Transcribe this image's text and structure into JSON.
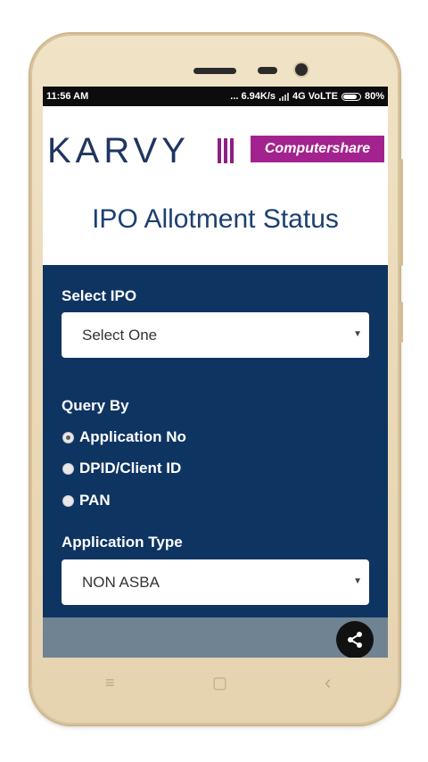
{
  "status_bar": {
    "time": "11:56 AM",
    "speed": "... 6.94K/s",
    "network": "4G VoLTE",
    "battery": "80%"
  },
  "header": {
    "logo_karvy": "KARVY",
    "logo_computershare": "Computershare",
    "title": "IPO Allotment Status"
  },
  "form": {
    "select_ipo_label": "Select IPO",
    "select_ipo_value": "Select One",
    "query_by_label": "Query By",
    "query_options": [
      {
        "label": "Application No",
        "selected": true
      },
      {
        "label": "DPID/Client ID",
        "selected": false
      },
      {
        "label": "PAN",
        "selected": false
      }
    ],
    "application_type_label": "Application Type",
    "application_type_value": "NON ASBA",
    "dropdown_caret": "▼"
  },
  "nav": {
    "menu_glyph": "≡",
    "home_glyph": "▢",
    "back_glyph": "‹"
  },
  "icons": {
    "share": "share-icon"
  },
  "colors": {
    "form_bg": "#0e3462",
    "title": "#1d3f72",
    "brand_purple": "#a3238e"
  }
}
